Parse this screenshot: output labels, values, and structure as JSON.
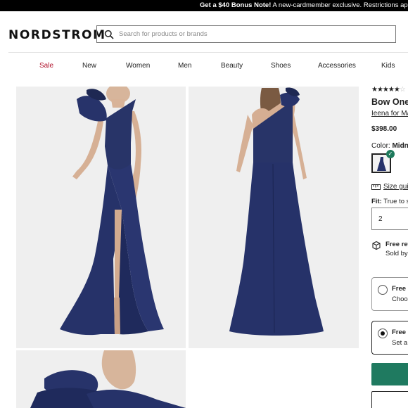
{
  "promo": {
    "bold": "Get a $40 Bonus Note!",
    "text": " A new-cardmember exclusive. Restrictions apply. A"
  },
  "header": {
    "logo": "NORDSTROM",
    "search_placeholder": "Search for products or brands"
  },
  "nav": {
    "items": [
      "Sale",
      "New",
      "Women",
      "Men",
      "Beauty",
      "Shoes",
      "Accessories",
      "Kids"
    ]
  },
  "gallery": {
    "dress_color": "#232f62",
    "background": "#efefef"
  },
  "product": {
    "rating": {
      "filled": "★★★★",
      "half": "★",
      "empty": "☆"
    },
    "title": "Bow One",
    "brand": "Ieena for Ma",
    "price": "$398.00",
    "color_label": "Color:",
    "color_value": "Midnig",
    "size_guide": "Size guid",
    "fit_label": "Fit:",
    "fit_value": "True to si",
    "quantity": "2",
    "returns_title": "Free ret",
    "returns_sub": "Sold by",
    "option1_title": "Free P",
    "option1_sub": "Choos",
    "option2_title": "Free S",
    "option2_sub": "Set a l",
    "accent_color": "#1f7a60",
    "sale_color": "#b0122b"
  }
}
